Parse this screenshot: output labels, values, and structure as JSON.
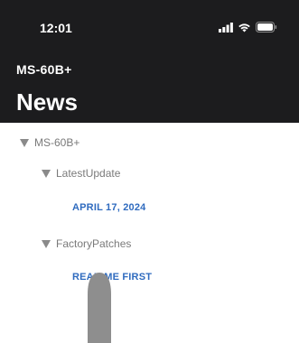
{
  "status": {
    "time": "12:01"
  },
  "header": {
    "subtitle": "MS-60B+",
    "title": "News"
  },
  "tree": {
    "root": {
      "label": "MS-60B+"
    },
    "latest": {
      "label": "LatestUpdate",
      "link": "APRIL 17, 2024"
    },
    "factory": {
      "label": "FactoryPatches",
      "link": "READ ME FIRST"
    }
  },
  "colors": {
    "header_bg": "#1c1c1e",
    "link": "#2f6bbf",
    "tree_text": "#7a7a7a"
  }
}
